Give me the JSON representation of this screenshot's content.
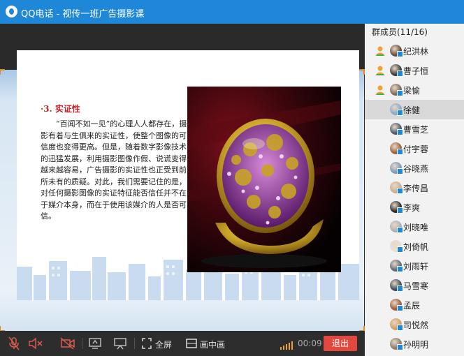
{
  "window": {
    "title": "QQ电话 - 视传一班广告摄影课"
  },
  "slide": {
    "heading": "·3. 实证性",
    "body": "“百闻不如一见”的心理人人都存在，摄影有着与生俱来的实证性，使整个图像的可信度也变得更高。但是，随着数字影像技术的迅猛发展，利用摄影图像作假、说谎变得越来越容易，广告摄影的实证性也正受到前所未有的质疑。对此，我们需要记住的是，对任何摄影图像的实证特征能否信任并不在于媒介本身，而在于使用该媒介的人是否可信。"
  },
  "sidebar": {
    "title": "群成员(11/16)",
    "members": [
      {
        "name": "纪洪林",
        "role": "admin"
      },
      {
        "name": "曹子恒",
        "role": "admin"
      },
      {
        "name": "梁愉",
        "role": "admin"
      },
      {
        "name": "徐健",
        "role": "selected"
      },
      {
        "name": "曹雪芝",
        "role": "member"
      },
      {
        "name": "付宇蓉",
        "role": "member"
      },
      {
        "name": "谷晓燕",
        "role": "member"
      },
      {
        "name": "李传昌",
        "role": "member"
      },
      {
        "name": "李爽",
        "role": "member"
      },
      {
        "name": "刘晓唯",
        "role": "member"
      },
      {
        "name": "刘倚帆",
        "role": "member"
      },
      {
        "name": "刘雨轩",
        "role": "member"
      },
      {
        "name": "马雪寒",
        "role": "member"
      },
      {
        "name": "孟辰",
        "role": "member"
      },
      {
        "name": "司悦然",
        "role": "member"
      },
      {
        "name": "孙明明",
        "role": "member"
      }
    ]
  },
  "controls": {
    "fullscreen_label": "全屏",
    "pip_label": "画中画",
    "timer": "00:09",
    "exit_label": "退出"
  },
  "colors": {
    "titlebar": "#1f87d8",
    "exit": "#e2483d",
    "heading": "#c4252a",
    "admin_icon": "#f0a030"
  }
}
